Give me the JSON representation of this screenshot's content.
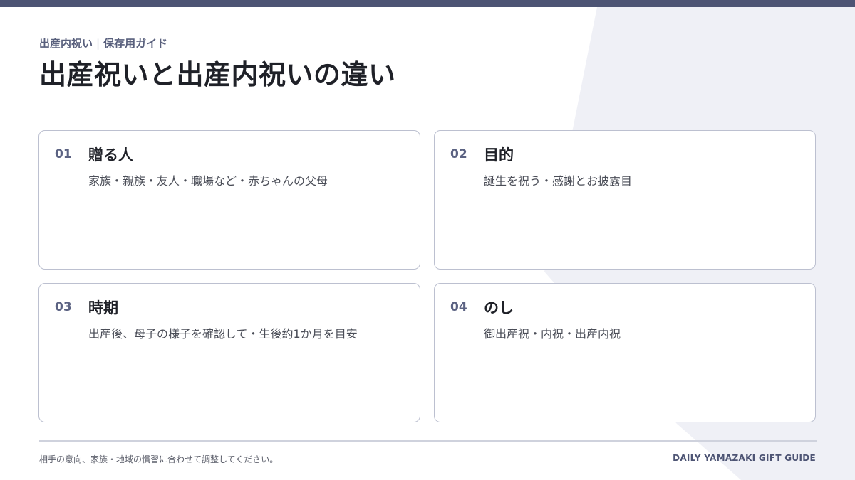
{
  "header": {
    "kicker_main": "出産内祝い",
    "kicker_separator": "|",
    "kicker_sub": "保存用ガイド",
    "title": "出産祝いと出産内祝いの違い"
  },
  "cards": [
    {
      "number": "01",
      "title": "贈る人",
      "text": "家族・親族・友人・職場など・赤ちゃんの父母"
    },
    {
      "number": "02",
      "title": "目的",
      "text": "誕生を祝う・感謝とお披露目"
    },
    {
      "number": "03",
      "title": "時期",
      "text": "出産後、母子の様子を確認して・生後約1か月を目安"
    },
    {
      "number": "04",
      "title": "のし",
      "text": "御出産祝・内祝・出産内祝"
    }
  ],
  "footer": {
    "note": "相手の意向、家族・地域の慣習に合わせて調整してください。",
    "brand": "DAILY YAMAZAKI GIFT GUIDE"
  },
  "colors": {
    "accent": "#4d5474",
    "background_shape": "#eff0f6",
    "card_border": "#bcc0d0",
    "title_text": "#1f2128"
  }
}
